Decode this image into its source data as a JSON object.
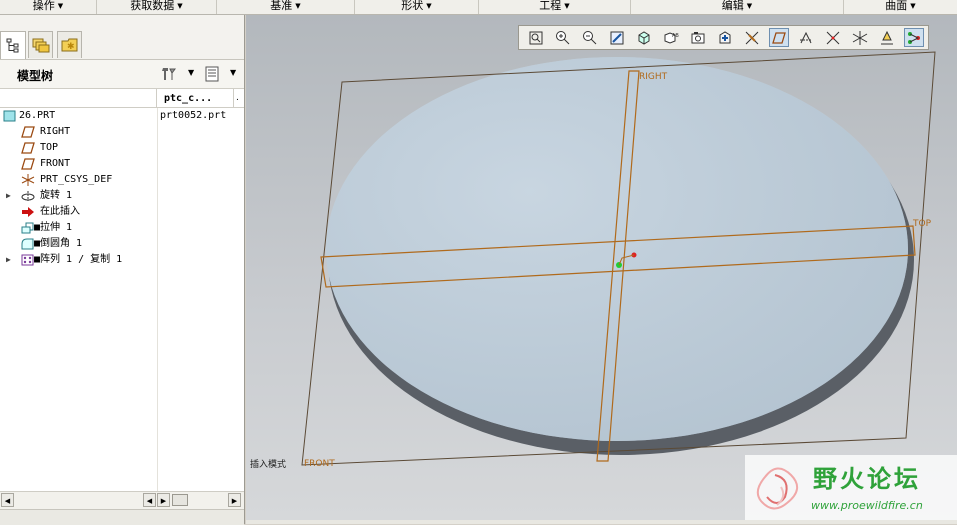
{
  "menubar": {
    "items": [
      {
        "label": "操作",
        "width": 97
      },
      {
        "label": "获取数据",
        "width": 120
      },
      {
        "label": "基准",
        "width": 138
      },
      {
        "label": "形状",
        "width": 124
      },
      {
        "label": "工程",
        "width": 152
      },
      {
        "label": "编辑",
        "width": 213
      },
      {
        "label": "曲面",
        "width": 113
      }
    ]
  },
  "model_tree": {
    "title": "模型树",
    "column_header": "ptc_c...",
    "column_header2": ".",
    "items": [
      {
        "label": "26.PRT",
        "value": "prt0052.prt",
        "icon": "part-icon",
        "indent": 0,
        "expandable": false
      },
      {
        "label": "RIGHT",
        "value": "",
        "icon": "datum-plane-icon",
        "indent": 1,
        "expandable": false
      },
      {
        "label": "TOP",
        "value": "",
        "icon": "datum-plane-icon",
        "indent": 1,
        "expandable": false
      },
      {
        "label": "FRONT",
        "value": "",
        "icon": "datum-plane-icon",
        "indent": 1,
        "expandable": false
      },
      {
        "label": "PRT_CSYS_DEF",
        "value": "",
        "icon": "csys-icon",
        "indent": 1,
        "expandable": false
      },
      {
        "label": "旋转 1",
        "value": "",
        "icon": "revolve-icon",
        "indent": 1,
        "expandable": true
      },
      {
        "label": "在此插入",
        "value": "",
        "icon": "insert-here-arrow-icon",
        "indent": 1,
        "expandable": false
      },
      {
        "label": "■拉伸 1",
        "value": "",
        "icon": "extrude-icon",
        "indent": 1,
        "expandable": false
      },
      {
        "label": "■倒圆角 1",
        "value": "",
        "icon": "round-icon",
        "indent": 1,
        "expandable": false
      },
      {
        "label": "■阵列 1 / 复制 1",
        "value": "",
        "icon": "pattern-icon",
        "indent": 1,
        "expandable": true
      }
    ]
  },
  "viewport": {
    "datum_labels": {
      "right": "RIGHT",
      "top": "TOP",
      "front": "FRONT"
    },
    "status_text": "插入模式",
    "toolbar_icons": [
      "refit-icon",
      "zoom-in-icon",
      "zoom-out-icon",
      "repaint-icon",
      "orient-icon",
      "saved-views-icon",
      "layers-icon",
      "spin-center-icon",
      "datum-planes-icon",
      "datum-axes-icon",
      "datum-points-icon",
      "csys-display-icon",
      "annotation-icon",
      "spin-center-toggle-icon",
      "network-icon"
    ]
  },
  "watermark": {
    "text": "野火论坛",
    "url": "www.proewildfire.cn"
  },
  "colors": {
    "accent": "#b06a1c",
    "part_fill": "#c2d0dc",
    "part_edge": "#5a5f66"
  }
}
